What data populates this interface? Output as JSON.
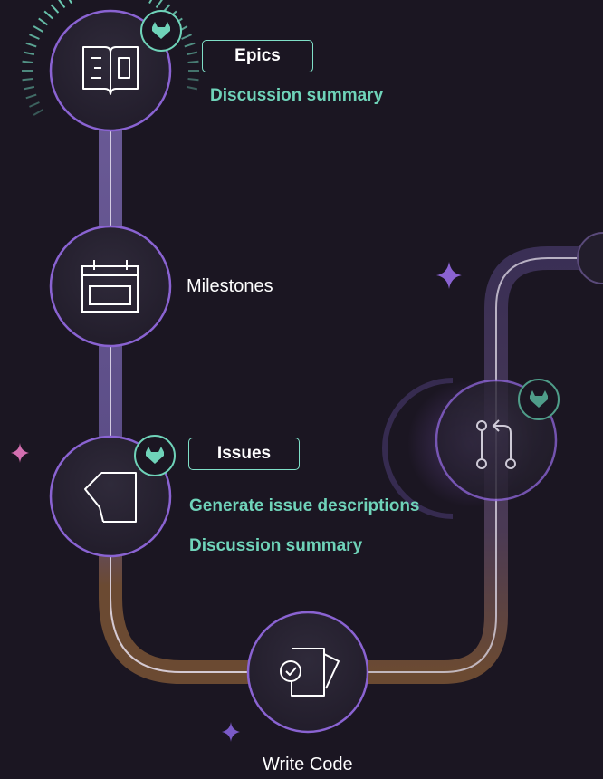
{
  "colors": {
    "background": "#1b1622",
    "accent_teal": "#6fd3b9",
    "node_ring": "#8a63d2",
    "path_purple": "#5b4a86",
    "path_brown": "#6b4a32",
    "node_fill": "#2a2533"
  },
  "nodes": [
    {
      "id": "epics",
      "icon": "book-icon",
      "badge": "gitlab-tanuki-icon"
    },
    {
      "id": "milestones",
      "icon": "calendar-icon"
    },
    {
      "id": "issues",
      "icon": "document-icon",
      "badge": "gitlab-tanuki-icon"
    },
    {
      "id": "write_code",
      "icon": "document-check-icon"
    },
    {
      "id": "merge_request",
      "icon": "merge-request-icon",
      "badge": "gitlab-tanuki-icon"
    }
  ],
  "epics": {
    "label": "Epics",
    "features": [
      "Discussion summary"
    ]
  },
  "milestones": {
    "label": "Milestones"
  },
  "issues": {
    "label": "Issues",
    "features": [
      "Generate issue descriptions",
      "Discussion summary"
    ]
  },
  "write_code": {
    "label": "Write Code"
  }
}
